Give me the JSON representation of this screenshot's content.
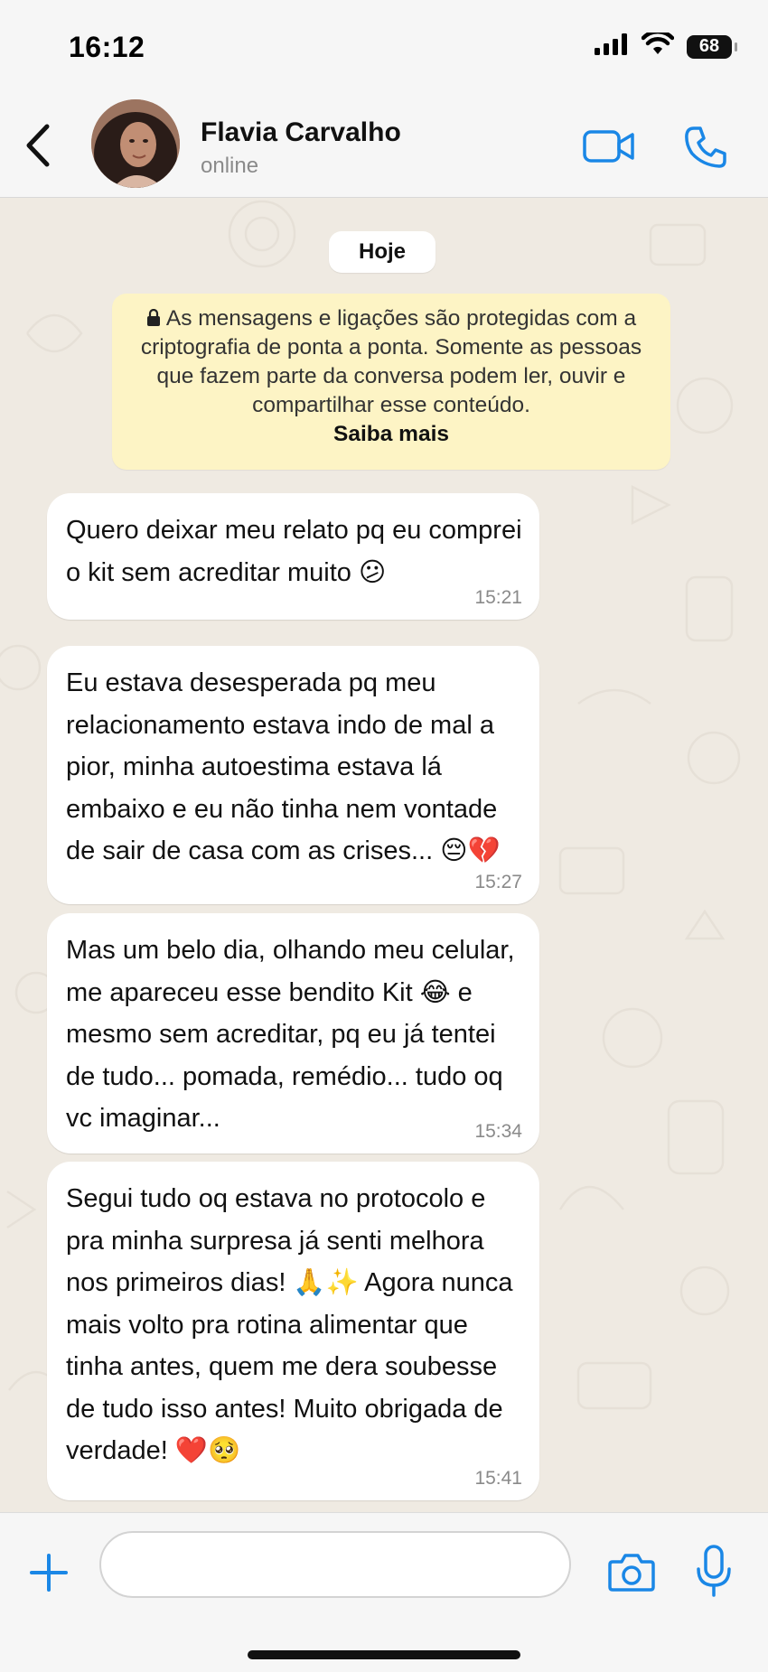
{
  "status_bar": {
    "time": "16:12",
    "battery": "68",
    "signal_icon": "cellular-signal-icon",
    "wifi_icon": "wifi-icon"
  },
  "header": {
    "contact_name": "Flavia Carvalho",
    "contact_status": "online",
    "back_icon": "chevron-left-icon",
    "video_icon": "video-camera-icon",
    "call_icon": "phone-icon"
  },
  "chat": {
    "date_label": "Hoje",
    "encryption_notice": "As mensagens e ligações são protegidas com a criptografia de ponta a ponta. Somente as pessoas que fazem parte da conversa podem ler, ouvir e compartilhar esse conteúdo.",
    "encryption_link": "Saiba mais",
    "messages": [
      {
        "text": "Quero deixar meu relato pq eu comprei o kit sem acreditar muito 😕",
        "time": "15:21"
      },
      {
        "text": "Eu estava desesperada pq meu relacionamento estava indo de mal a pior, minha autoestima estava lá embaixo e eu não tinha nem vontade de sair de casa com as crises... 😔💔",
        "time": "15:27"
      },
      {
        "text": "Mas um belo dia, olhando meu celular, me apareceu esse bendito Kit 😂 e mesmo sem acreditar, pq eu já tentei de tudo... pomada, remédio... tudo oq vc imaginar...",
        "time": "15:34"
      },
      {
        "text": "Segui tudo oq estava no protocolo e pra minha surpresa já senti melhora nos primeiros dias! 🙏✨ Agora nunca mais volto pra rotina alimentar que tinha antes, quem me dera soubesse de tudo isso antes! Muito obrigada de verdade! ❤️🥺",
        "time": "15:41"
      }
    ]
  },
  "composer": {
    "input_value": "",
    "plus_icon": "plus-icon",
    "camera_icon": "camera-icon",
    "mic_icon": "microphone-icon"
  },
  "colors": {
    "accent": "#1a87e6",
    "chat_background": "#efeae2",
    "notice_background": "#fdf4c5",
    "bubble_background": "#ffffff"
  }
}
